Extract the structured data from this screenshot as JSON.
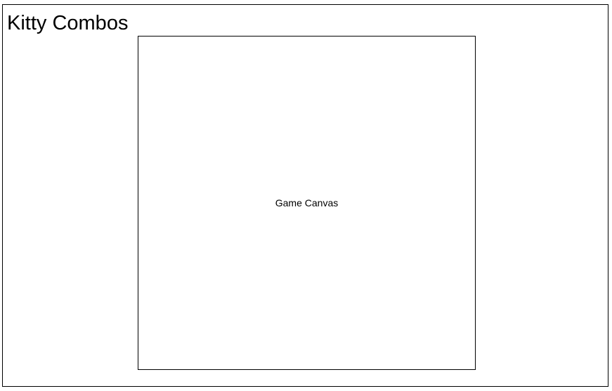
{
  "app": {
    "title": "Kitty Combos"
  },
  "game": {
    "canvas_label": "Game Canvas"
  }
}
